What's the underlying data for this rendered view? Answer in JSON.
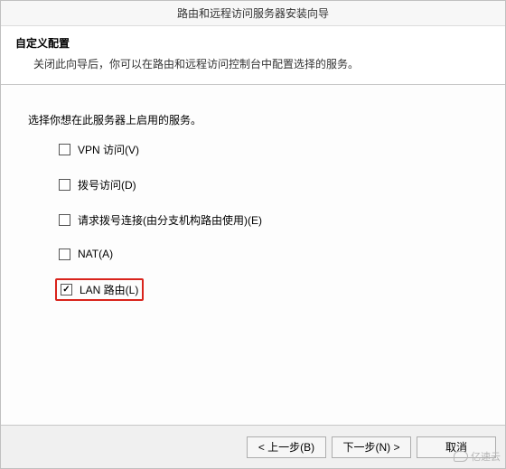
{
  "window": {
    "title": "路由和远程访问服务器安装向导"
  },
  "header": {
    "title": "自定义配置",
    "description": "关闭此向导后，你可以在路由和远程访问控制台中配置选择的服务。"
  },
  "main": {
    "prompt": "选择你想在此服务器上启用的服务。",
    "options": [
      {
        "label": "VPN 访问(V)",
        "checked": false,
        "highlight": false
      },
      {
        "label": "拨号访问(D)",
        "checked": false,
        "highlight": false
      },
      {
        "label": "请求拨号连接(由分支机构路由使用)(E)",
        "checked": false,
        "highlight": false
      },
      {
        "label": "NAT(A)",
        "checked": false,
        "highlight": false
      },
      {
        "label": "LAN 路由(L)",
        "checked": true,
        "highlight": true
      }
    ]
  },
  "buttons": {
    "back": "< 上一步(B)",
    "next": "下一步(N) >",
    "cancel": "取消"
  },
  "watermark": {
    "text": "亿速云"
  }
}
